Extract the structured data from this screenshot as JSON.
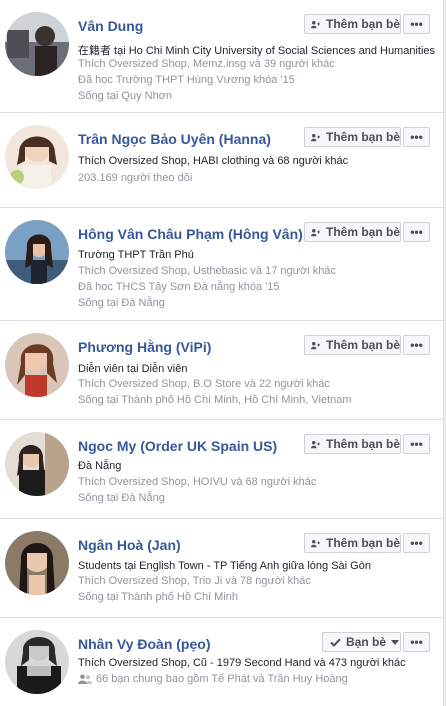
{
  "buttons": {
    "add_friend": "Thêm bạn bè",
    "friends": "Bạn bè",
    "more": "•••"
  },
  "people": [
    {
      "name": "Vân Dung",
      "lines": [
        {
          "text": "在籍者 tại Ho Chi Minh City University of Social Sciences and Humanities",
          "style": "dark"
        },
        {
          "text": "Thích Oversized Shop, Memz.insg và 39 người khác",
          "style": "muted"
        },
        {
          "text": "Đã học Trường THPT Hùng Vương khóa '15",
          "style": "muted"
        },
        {
          "text": "Sống tại Quy Nhơn",
          "style": "muted"
        }
      ],
      "action": "add"
    },
    {
      "name": "Trân Ngọc Bảo Uyên (Hanna)",
      "lines": [
        {
          "text": "Thích Oversized Shop, HABI clothing và 68 người khác",
          "style": "dark"
        },
        {
          "text": "203.169 người theo dõi",
          "style": "muted"
        }
      ],
      "action": "add"
    },
    {
      "name": "Hông Vân Châu Phạm (Hông Vân)",
      "lines": [
        {
          "text": "Trường THPT Trần Phú",
          "style": "dark"
        },
        {
          "text": "Thích Oversized Shop, Usthebasic và 17 người khác",
          "style": "muted"
        },
        {
          "text": "Đã học THCS Tây Sơn Đà nẵng khóa '15",
          "style": "muted"
        },
        {
          "text": "Sống tại Đà Nẵng",
          "style": "muted"
        }
      ],
      "action": "add"
    },
    {
      "name": "Phương Hằng (ViPi)",
      "lines": [
        {
          "text": "Diễn viên tại Diễn viên",
          "style": "dark"
        },
        {
          "text": "Thích Oversized Shop, B.O Store và 22 người khác",
          "style": "muted"
        },
        {
          "text": "Sống tại Thành phố Hồ Chí Minh, Hồ Chí Minh, Vietnam",
          "style": "muted"
        }
      ],
      "action": "add"
    },
    {
      "name": "Ngoc My (Order UK Spain US)",
      "lines": [
        {
          "text": "Đà Nẵng",
          "style": "dark"
        },
        {
          "text": "Thích Oversized Shop, HOIVU và 68 người khác",
          "style": "muted"
        },
        {
          "text": "Sống tại Đà Nẵng",
          "style": "muted"
        }
      ],
      "action": "add"
    },
    {
      "name": "Ngân Hoà (Jan)",
      "lines": [
        {
          "text": "Students tại English Town - TP Tiếng Anh giữa lòng Sài Gòn",
          "style": "dark"
        },
        {
          "text": "Thích Oversized Shop, Trio Ji và 78 người khác",
          "style": "muted"
        },
        {
          "text": "Sống tại Thành phố Hồ Chí Minh",
          "style": "muted"
        }
      ],
      "action": "add"
    },
    {
      "name": "Nhân Vy Đoàn (pẹo)",
      "lines": [
        {
          "text": "Thích Oversized Shop, Cũ - 1979 Second Hand và 473 người khác",
          "style": "dark"
        },
        {
          "text": "66 bạn chung bao gồm Tế Phát và Trần Huy Hoàng",
          "style": "muted-icon"
        }
      ],
      "action": "friends"
    }
  ],
  "colors": {
    "name_link": "#365899",
    "muted_text": "#90949c",
    "dark_text": "#1d2129"
  }
}
